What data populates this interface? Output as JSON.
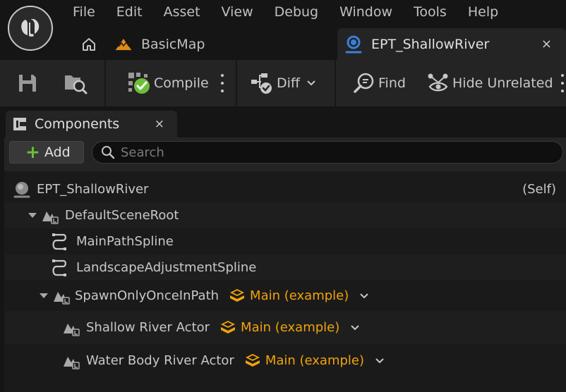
{
  "menu": [
    "File",
    "Edit",
    "Asset",
    "View",
    "Debug",
    "Window",
    "Tools",
    "Help"
  ],
  "tabs": {
    "basicmap": "BasicMap",
    "active": "EPT_ShallowRiver",
    "close": "×"
  },
  "toolbar": {
    "compile": "Compile",
    "diff": "Diff",
    "find": "Find",
    "hide_unrelated": "Hide Unrelated"
  },
  "components_panel": {
    "title": "Components",
    "close": "×",
    "add_label": "Add",
    "search_placeholder": "Search",
    "root": {
      "label": "EPT_ShallowRiver",
      "tag": "(Self)"
    },
    "nodes": [
      {
        "label": "DefaultSceneRoot",
        "icon": "scene-component-icon"
      },
      {
        "label": "MainPathSpline",
        "icon": "spline-icon"
      },
      {
        "label": "LandscapeAdjustmentSpline",
        "icon": "spline-icon"
      },
      {
        "label": "SpawnOnlyOnceInPath",
        "icon": "scene-component-icon",
        "variation": "Main (example)"
      },
      {
        "label": "Shallow River Actor",
        "icon": "scene-component-icon",
        "variation": "Main (example)"
      },
      {
        "label": "Water Body River Actor",
        "icon": "scene-component-icon",
        "variation": "Main (example)"
      }
    ]
  },
  "colors": {
    "accent_orange": "#f0a30a",
    "add_green": "#6cbf3a",
    "blueprint_blue": "#3b7fd9"
  }
}
